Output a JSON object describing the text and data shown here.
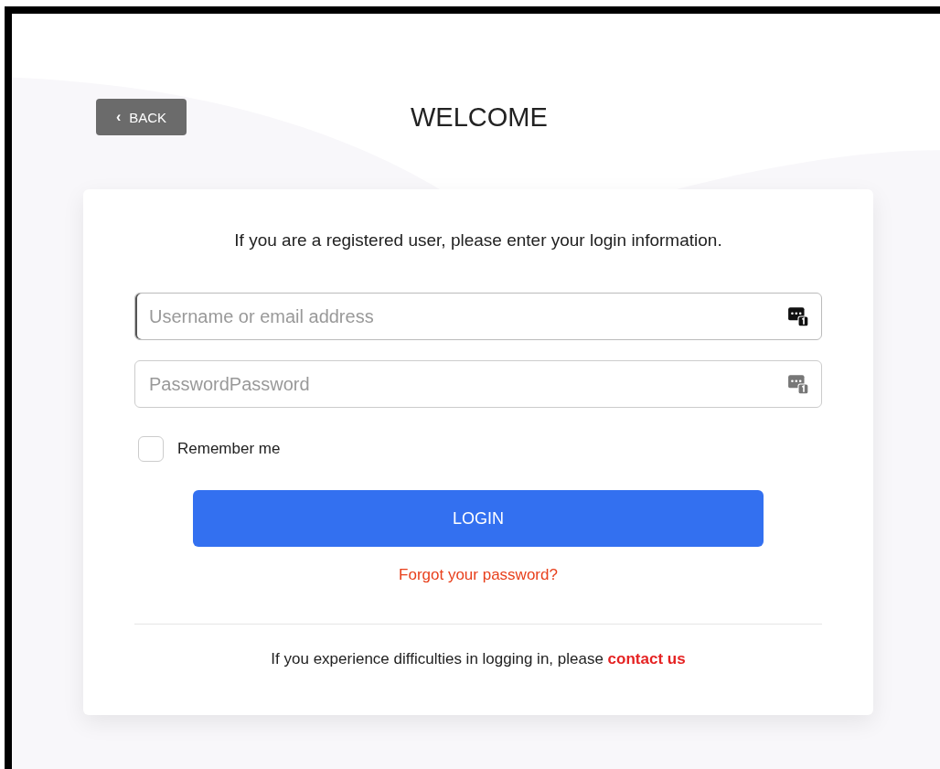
{
  "back_button": {
    "label": "BACK",
    "icon": "‹"
  },
  "title": "WELCOME",
  "card": {
    "intro": "If you are a registered user, please enter your login information.",
    "fields": [
      {
        "placeholder": "Username or email address",
        "focused": true,
        "icon_active": true
      },
      {
        "placeholder": "PasswordPassword",
        "focused": false,
        "icon_active": false
      }
    ],
    "remember": {
      "label": "Remember me",
      "checked": false
    },
    "login_button": "LOGIN",
    "forgot_link": "Forgot your password?",
    "footer": {
      "text": "If you experience difficulties in logging in, please",
      "link": "contact us"
    }
  }
}
